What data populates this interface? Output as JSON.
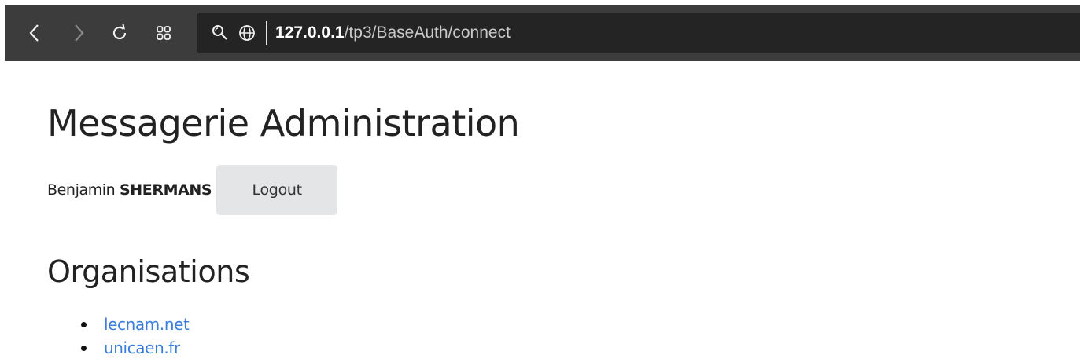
{
  "browser": {
    "url_host": "127.0.0.1",
    "url_path": "/tp3/BaseAuth/connect"
  },
  "page": {
    "title": "Messagerie Administration",
    "user": {
      "first_name": "Benjamin",
      "last_name": "SHERMANS"
    },
    "logout_label": "Logout",
    "section_title": "Organisations",
    "organisations": [
      "lecnam.net",
      "unicaen.fr"
    ]
  },
  "colors": {
    "toolbar": "#3c3c3c",
    "url_box": "#242424",
    "link": "#3b7ddd",
    "logout_button": "#e4e5e6"
  },
  "icons": [
    "back-arrow-icon",
    "forward-arrow-icon",
    "reload-icon",
    "tab-grid-icon",
    "search-icon",
    "globe-icon"
  ]
}
